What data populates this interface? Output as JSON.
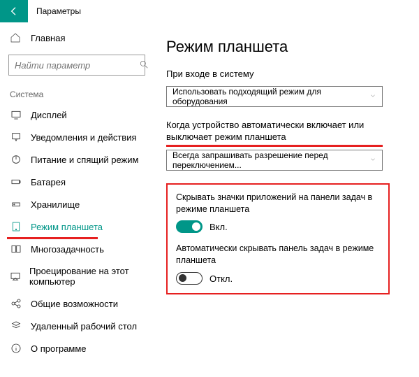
{
  "app_title": "Параметры",
  "home_label": "Главная",
  "search_placeholder": "Найти параметр",
  "section_title": "Система",
  "sidebar": {
    "items": [
      {
        "label": "Дисплей"
      },
      {
        "label": "Уведомления и действия"
      },
      {
        "label": "Питание и спящий режим"
      },
      {
        "label": "Батарея"
      },
      {
        "label": "Хранилище"
      },
      {
        "label": "Режим планшета"
      },
      {
        "label": "Многозадачность"
      },
      {
        "label": "Проецирование на этот компьютер"
      },
      {
        "label": "Общие возможности"
      },
      {
        "label": "Удаленный рабочий стол"
      },
      {
        "label": "О программе"
      }
    ]
  },
  "page_title": "Режим планшета",
  "signin": {
    "label": "При входе в систему",
    "value": "Использовать подходящий режим для оборудования"
  },
  "autoswitch": {
    "label": "Когда устройство автоматически включает или выключает режим планшета",
    "value": "Всегда запрашивать разрешение перед переключением..."
  },
  "toggle1": {
    "label": "Скрывать значки приложений на панели задач в режиме планшета",
    "state": "Вкл."
  },
  "toggle2": {
    "label": "Автоматически скрывать панель задач в режиме планшета",
    "state": "Откл."
  }
}
